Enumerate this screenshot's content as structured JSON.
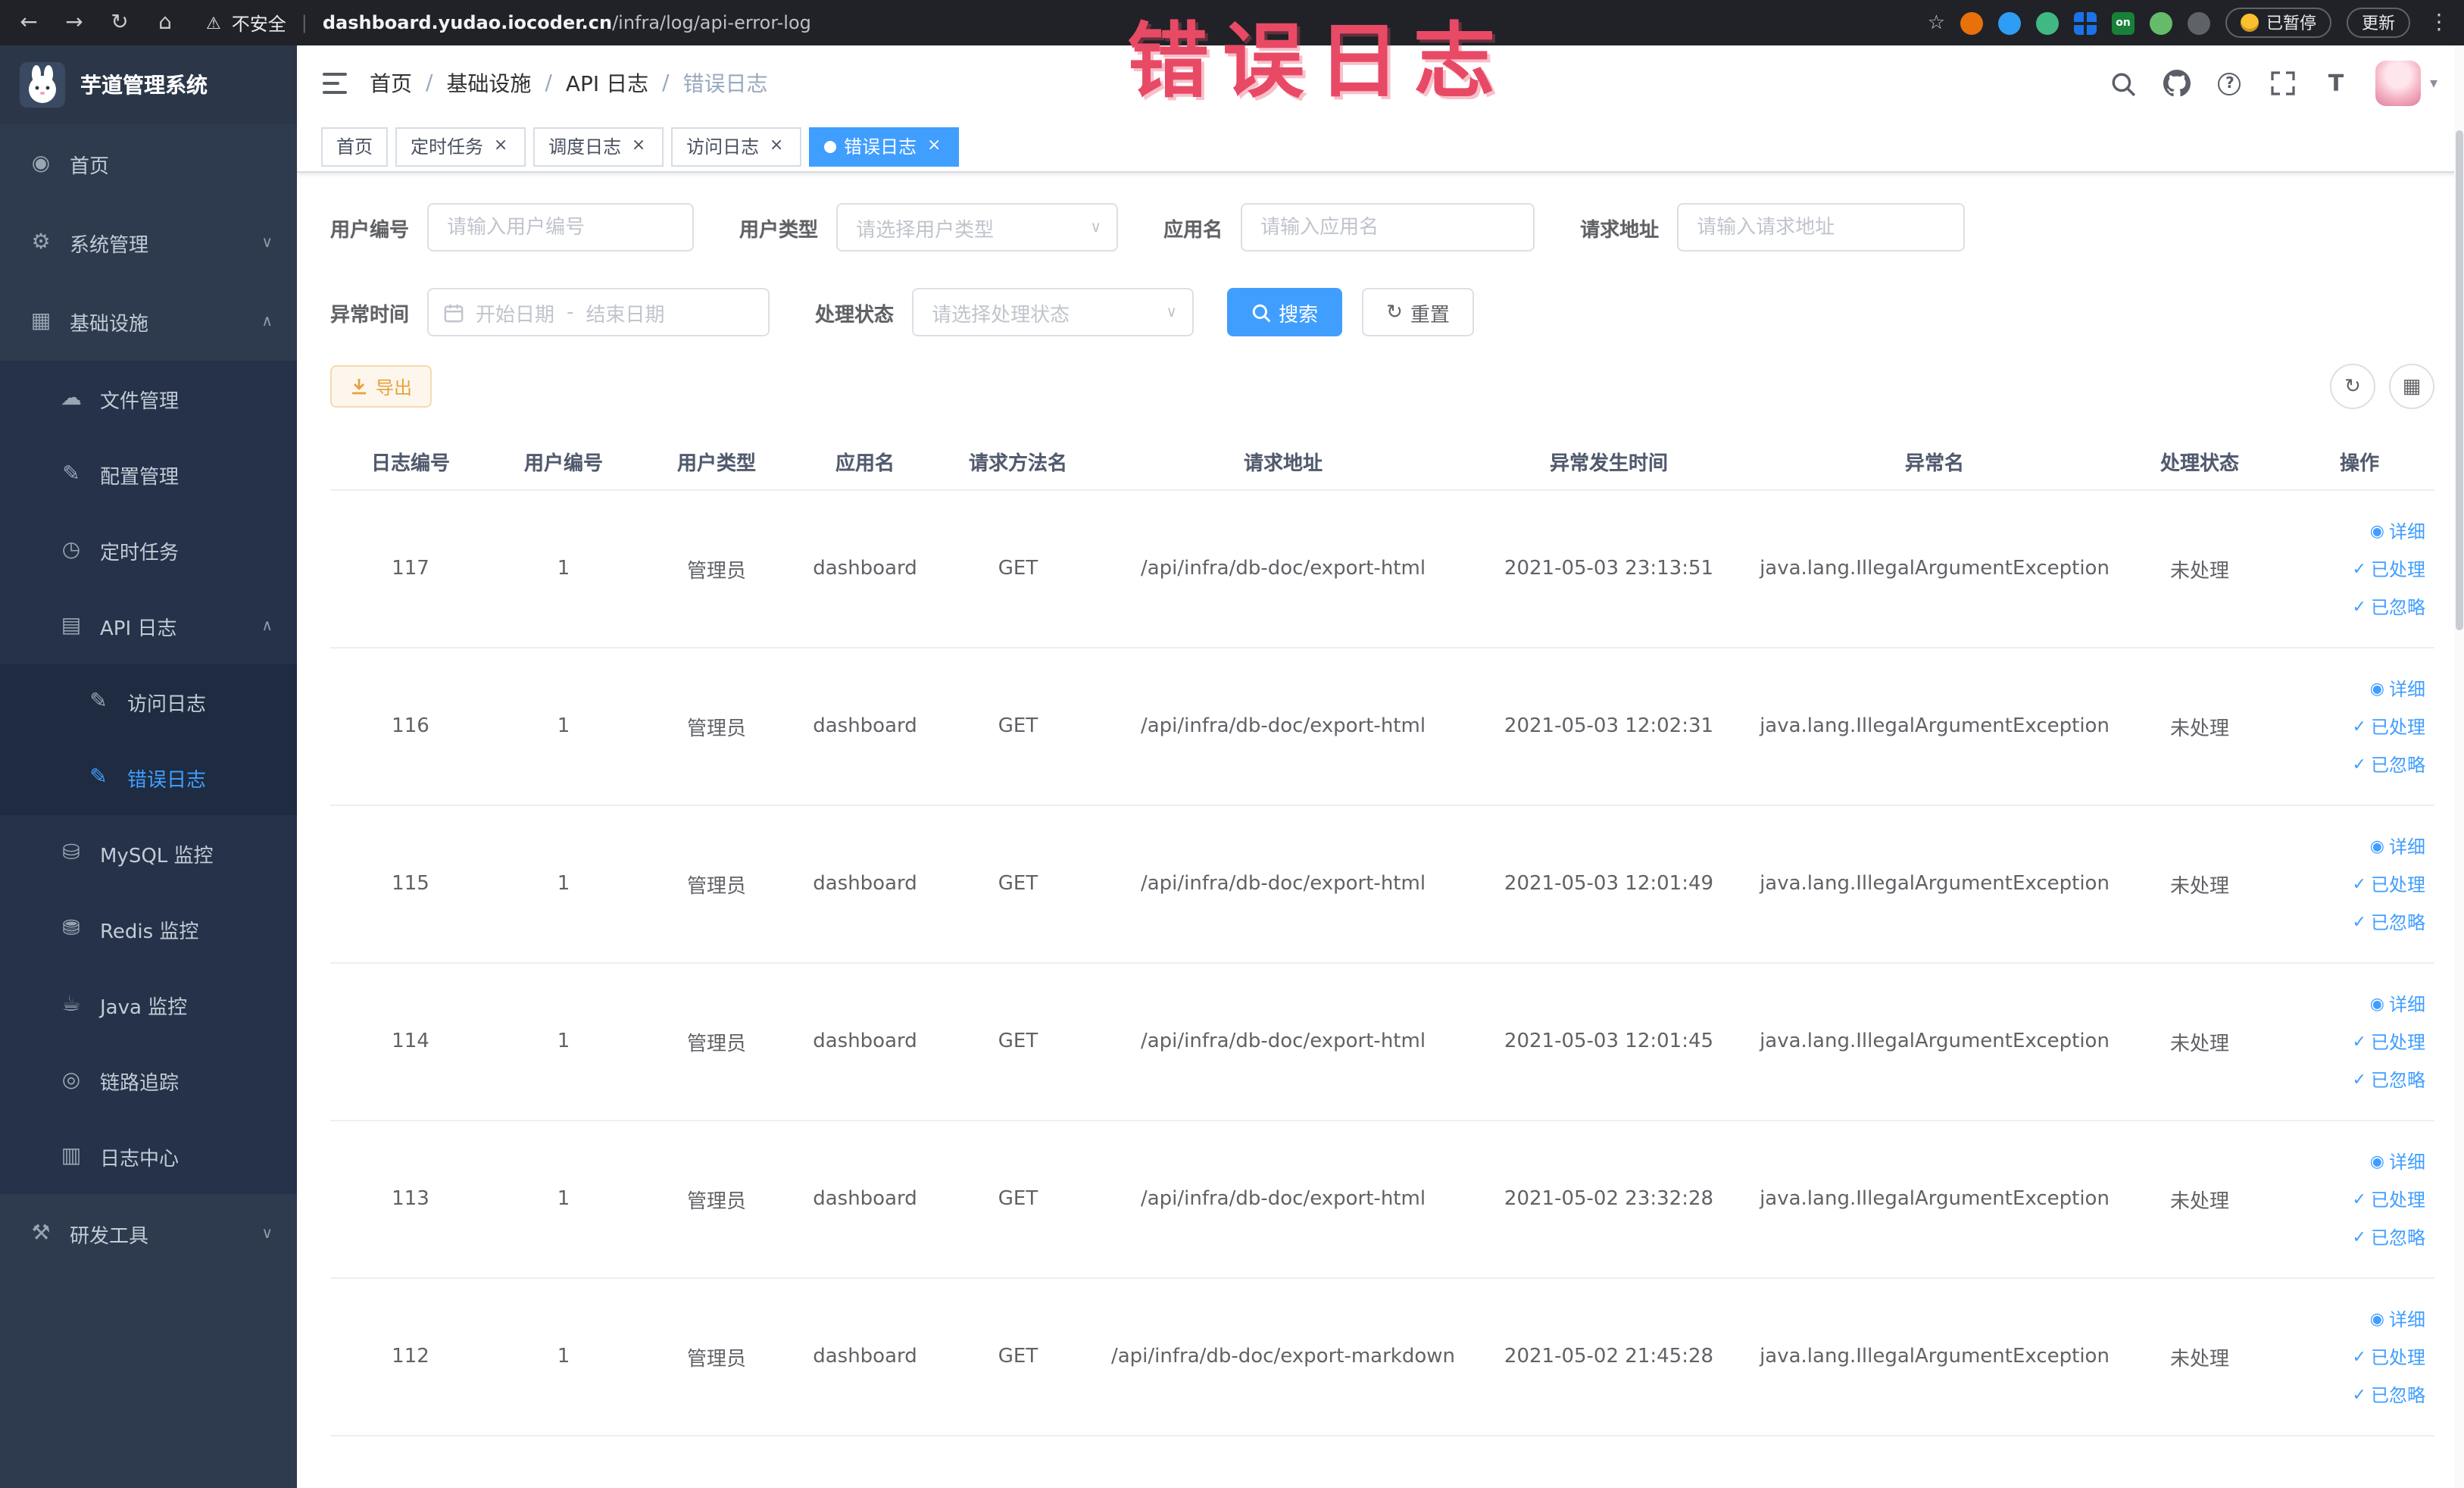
{
  "browser": {
    "security_label": "不安全",
    "url_domain": "dashboard.yudao.iocoder.cn",
    "url_path": "/infra/log/api-error-log",
    "extension_on_label": "on",
    "paused_label": "已暂停",
    "update_label": "更新"
  },
  "annotation": {
    "text": "错误日志"
  },
  "icons": {
    "back": "←",
    "forward": "→",
    "reload": "↻",
    "home": "⌂",
    "warning": "⚠",
    "star": "☆",
    "kebab": "⋮",
    "divider": "|",
    "chevron_down": "∨",
    "chevron_up": "∧",
    "caret_down": "▾",
    "help": "?",
    "size_t": "T",
    "refresh": "↻",
    "grid": "▦"
  },
  "sidebar": {
    "logo_title": "芋道管理系统",
    "items": [
      {
        "label": "首页",
        "icon": "◉"
      },
      {
        "label": "系统管理",
        "icon": "⚙",
        "chevron": "∨"
      },
      {
        "label": "基础设施",
        "icon": "▦",
        "chevron": "∧"
      },
      {
        "label": "文件管理",
        "icon": "☁"
      },
      {
        "label": "配置管理",
        "icon": "✎"
      },
      {
        "label": "定时任务",
        "icon": "◷"
      },
      {
        "label": "API 日志",
        "icon": "▤",
        "chevron": "∧"
      },
      {
        "label": "访问日志",
        "icon": "✎"
      },
      {
        "label": "错误日志",
        "icon": "✎"
      },
      {
        "label": "MySQL 监控",
        "icon": "⛁"
      },
      {
        "label": "Redis 监控",
        "icon": "⛃"
      },
      {
        "label": "Java 监控",
        "icon": "☕"
      },
      {
        "label": "链路追踪",
        "icon": "◎"
      },
      {
        "label": "日志中心",
        "icon": "▥"
      },
      {
        "label": "研发工具",
        "icon": "⚒",
        "chevron": "∨"
      }
    ]
  },
  "breadcrumb": {
    "separator": "/",
    "items": [
      "首页",
      "基础设施",
      "API 日志",
      "错误日志"
    ]
  },
  "tabs": [
    {
      "label": "首页"
    },
    {
      "label": "定时任务",
      "close": "×"
    },
    {
      "label": "调度日志",
      "close": "×"
    },
    {
      "label": "访问日志",
      "close": "×"
    },
    {
      "label": "错误日志",
      "close": "×",
      "active": true
    }
  ],
  "filters": {
    "user_id": {
      "label": "用户编号",
      "placeholder": "请输入用户编号"
    },
    "user_type": {
      "label": "用户类型",
      "placeholder": "请选择用户类型"
    },
    "app_name": {
      "label": "应用名",
      "placeholder": "请输入应用名"
    },
    "request_url": {
      "label": "请求地址",
      "placeholder": "请输入请求地址"
    },
    "exception_time": {
      "label": "异常时间",
      "start_placeholder": "开始日期",
      "separator": "-",
      "end_placeholder": "结束日期"
    },
    "process_status": {
      "label": "处理状态",
      "placeholder": "请选择处理状态"
    },
    "search_label": "搜索",
    "reset_label": "重置"
  },
  "toolbar": {
    "export_label": "导出"
  },
  "table": {
    "columns": [
      "日志编号",
      "用户编号",
      "用户类型",
      "应用名",
      "请求方法名",
      "请求地址",
      "异常发生时间",
      "异常名",
      "处理状态",
      "操作"
    ],
    "row_actions": [
      {
        "icon": "◉",
        "label": "详细"
      },
      {
        "icon": "✓",
        "label": "已处理"
      },
      {
        "icon": "✓",
        "label": "已忽略"
      }
    ],
    "rows": [
      {
        "id": "117",
        "user_id": "1",
        "user_type": "管理员",
        "app": "dashboard",
        "method": "GET",
        "url": "/api/infra/db-doc/export-html",
        "time": "2021-05-03 23:13:51",
        "exception": "java.lang.IllegalArgumentException",
        "status": "未处理"
      },
      {
        "id": "116",
        "user_id": "1",
        "user_type": "管理员",
        "app": "dashboard",
        "method": "GET",
        "url": "/api/infra/db-doc/export-html",
        "time": "2021-05-03 12:02:31",
        "exception": "java.lang.IllegalArgumentException",
        "status": "未处理"
      },
      {
        "id": "115",
        "user_id": "1",
        "user_type": "管理员",
        "app": "dashboard",
        "method": "GET",
        "url": "/api/infra/db-doc/export-html",
        "time": "2021-05-03 12:01:49",
        "exception": "java.lang.IllegalArgumentException",
        "status": "未处理"
      },
      {
        "id": "114",
        "user_id": "1",
        "user_type": "管理员",
        "app": "dashboard",
        "method": "GET",
        "url": "/api/infra/db-doc/export-html",
        "time": "2021-05-03 12:01:45",
        "exception": "java.lang.IllegalArgumentException",
        "status": "未处理"
      },
      {
        "id": "113",
        "user_id": "1",
        "user_type": "管理员",
        "app": "dashboard",
        "method": "GET",
        "url": "/api/infra/db-doc/export-html",
        "time": "2021-05-02 23:32:28",
        "exception": "java.lang.IllegalArgumentException",
        "status": "未处理"
      },
      {
        "id": "112",
        "user_id": "1",
        "user_type": "管理员",
        "app": "dashboard",
        "method": "GET",
        "url": "/api/infra/db-doc/export-markdown",
        "time": "2021-05-02 21:45:28",
        "exception": "java.lang.IllegalArgumentException",
        "status": "未处理"
      }
    ]
  }
}
